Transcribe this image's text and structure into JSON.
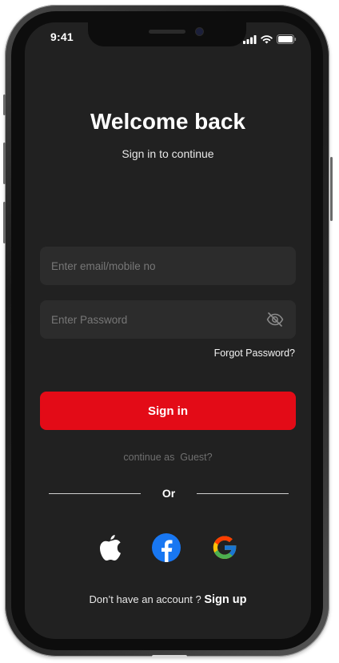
{
  "status_bar": {
    "time": "9:41",
    "icons": [
      "signal-icon",
      "wifi-icon",
      "battery-icon"
    ]
  },
  "header": {
    "title": "Welcome back",
    "subtitle": "Sign in to continue"
  },
  "form": {
    "email_placeholder": "Enter email/mobile no",
    "email_value": "",
    "password_placeholder": "Enter Password",
    "password_value": "",
    "password_toggle_icon": "eye-off-icon",
    "forgot_password": "Forgot Password?"
  },
  "actions": {
    "signin_label": "Sign in",
    "guest_prefix": "continue as",
    "guest_link": "Guest?",
    "divider_label": "Or"
  },
  "social_login": [
    {
      "name": "apple",
      "icon": "apple-icon"
    },
    {
      "name": "facebook",
      "icon": "facebook-icon"
    },
    {
      "name": "google",
      "icon": "google-icon"
    }
  ],
  "footer": {
    "prompt": "Don’t have an account ?",
    "signup_label": "Sign up"
  },
  "colors": {
    "background": "#212121",
    "field_background": "#2c2c2c",
    "primary_button": "#e30b17",
    "facebook_blue": "#1877f2"
  }
}
